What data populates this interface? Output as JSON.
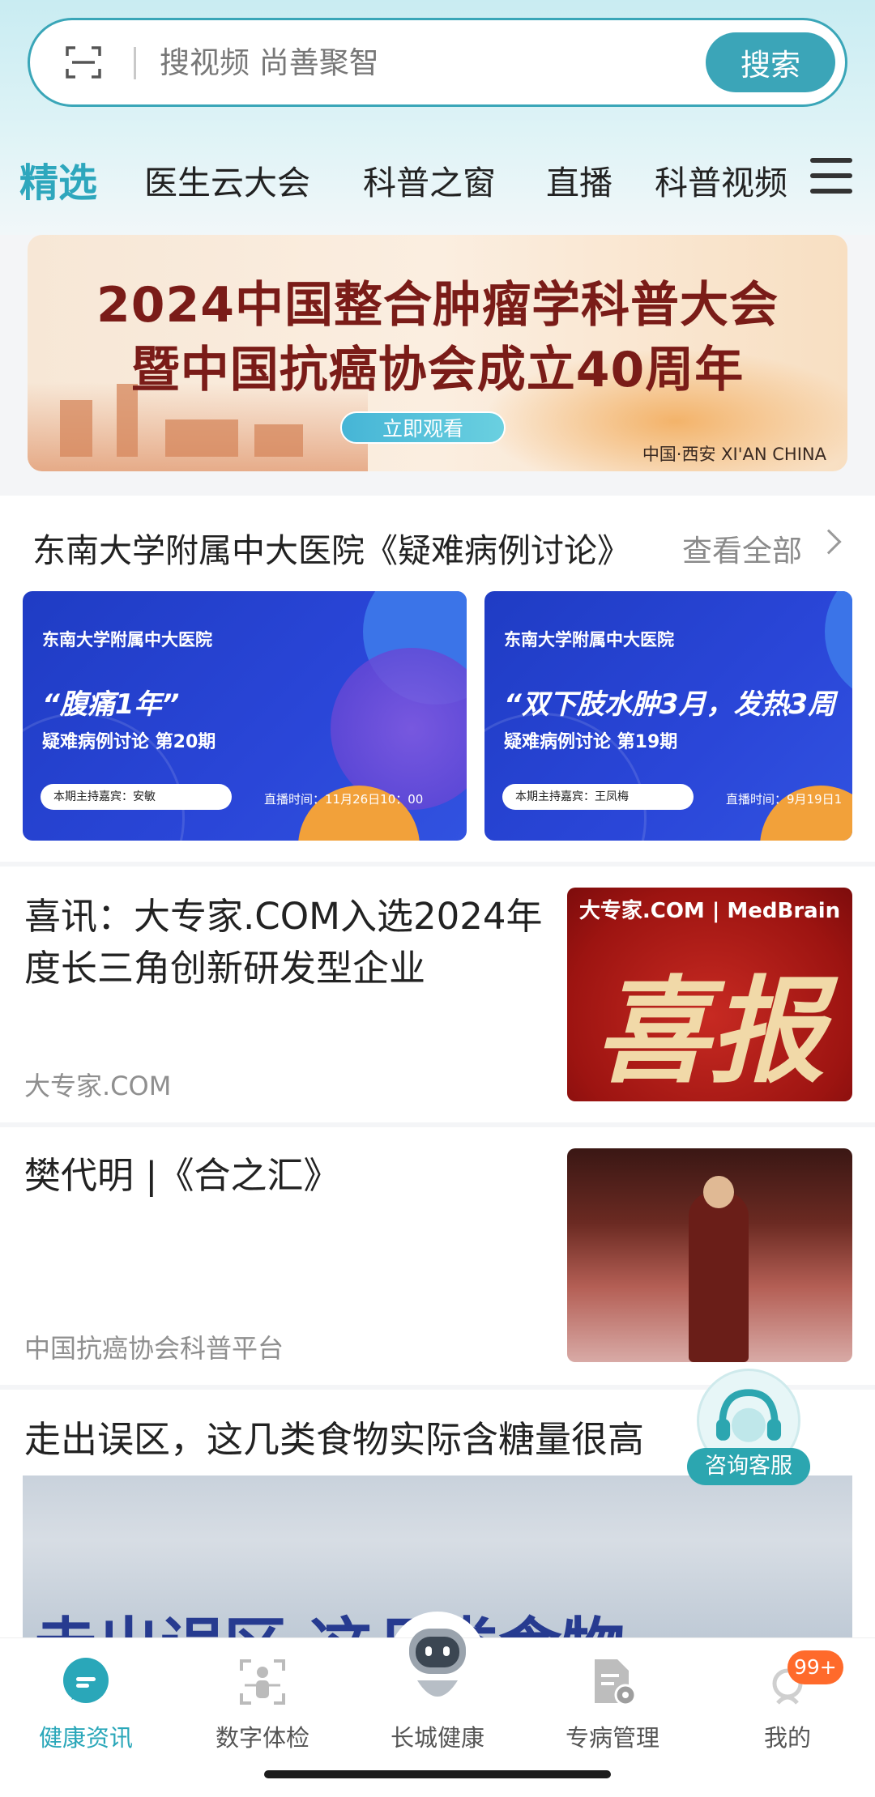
{
  "search": {
    "placeholder": "搜视频 尚善聚智",
    "button_label": "搜索"
  },
  "tabs": [
    {
      "label": "精选",
      "active": true
    },
    {
      "label": "医生云大会",
      "active": false
    },
    {
      "label": "科普之窗",
      "active": false
    },
    {
      "label": "直播",
      "active": false
    },
    {
      "label": "科普视频",
      "active": false
    }
  ],
  "banner": {
    "line1": "2024中国整合肿瘤学科普大会",
    "line2": "暨中国抗癌协会成立40周年",
    "button_label": "立即观看",
    "location": "中国·西安  XI'AN CHINA"
  },
  "case_section": {
    "title": "东南大学附属中大医院《疑难病例讨论》",
    "more_label": "查看全部",
    "cards": [
      {
        "hospital": "东南大学附属中大医院",
        "quote": "“腹痛1年”",
        "issue": "疑难病例讨论 第20期",
        "host": "本期主持嘉宾：安敏",
        "time": "直播时间：11月26日10：00"
      },
      {
        "hospital": "东南大学附属中大医院",
        "quote": "“双下肢水肿3月，发热3周",
        "issue": "疑难病例讨论 第19期",
        "host": "本期主持嘉宾：王凤梅",
        "time": "直播时间：9月19日1"
      }
    ]
  },
  "news": [
    {
      "title": "喜讯：大专家.COM入选2024年度长三角创新研发型企业",
      "source": "大专家.COM",
      "thumb_logo": "大专家.COM | MedBrain",
      "thumb_text": "喜报"
    },
    {
      "title": "樊代明 |《合之汇》",
      "source": "中国抗癌协会科普平台"
    },
    {
      "title": "走出误区，这几类食物实际含糖量很高",
      "video_text": "走出误区 这几类食物"
    }
  ],
  "service": {
    "label": "咨询客服"
  },
  "bottom_nav": [
    {
      "label": "健康资讯",
      "icon": "chat-bubble-icon",
      "active": true
    },
    {
      "label": "数字体检",
      "icon": "body-scan-icon",
      "active": false
    },
    {
      "label": "长城健康",
      "icon": "robot-icon",
      "active": false
    },
    {
      "label": "专病管理",
      "icon": "document-gear-icon",
      "active": false
    },
    {
      "label": "我的",
      "icon": "profile-icon",
      "active": false
    }
  ],
  "badge": "99+",
  "colors": {
    "accent": "#2ea7bd",
    "case_card_blue": "#2a46d8",
    "banner_title": "#7a1c18",
    "badge": "#ff6a2b"
  }
}
